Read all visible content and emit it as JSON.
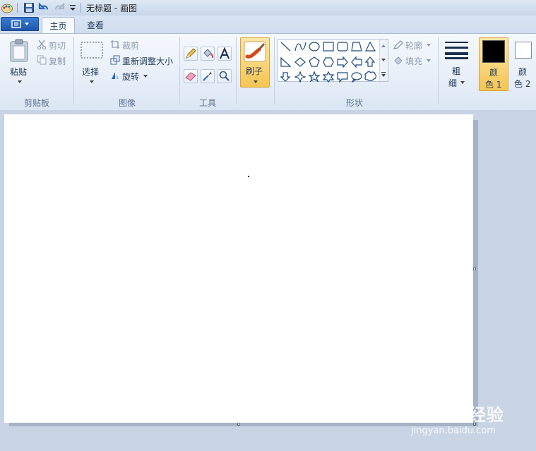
{
  "window": {
    "title": "无标题 - 画图"
  },
  "quick_access": {
    "icons": [
      "paint-app-icon",
      "save-icon",
      "undo-icon",
      "redo-icon",
      "customize-dropdown-icon"
    ]
  },
  "tabs": [
    {
      "label": "主页",
      "active": true
    },
    {
      "label": "查看",
      "active": false
    }
  ],
  "clipboard": {
    "paste": "粘贴",
    "cut": "剪切",
    "copy": "复制",
    "group": "剪贴板"
  },
  "image": {
    "select": "选择",
    "crop": "裁剪",
    "resize": "重新调整大小",
    "rotate": "旋转",
    "group": "图像"
  },
  "tools": {
    "group": "工具",
    "items": [
      "pencil-icon",
      "fill-icon",
      "text-icon",
      "eraser-icon",
      "color-picker-icon",
      "magnifier-icon"
    ]
  },
  "brushes": {
    "label": "刷子"
  },
  "shapes": {
    "group": "形状",
    "outline": "轮廓",
    "fill": "填充"
  },
  "size": {
    "label_line1": "粗",
    "label_line2": "细"
  },
  "colors": {
    "color1_line1": "颜",
    "color1_line2": "色 1",
    "color2_line1": "颜",
    "color2_line2": "色 2",
    "color1_value": "#000000",
    "color2_value": "#ffffff"
  },
  "watermark": {
    "brand": "Baidu经验",
    "url": "jingyan.baidu.com"
  }
}
